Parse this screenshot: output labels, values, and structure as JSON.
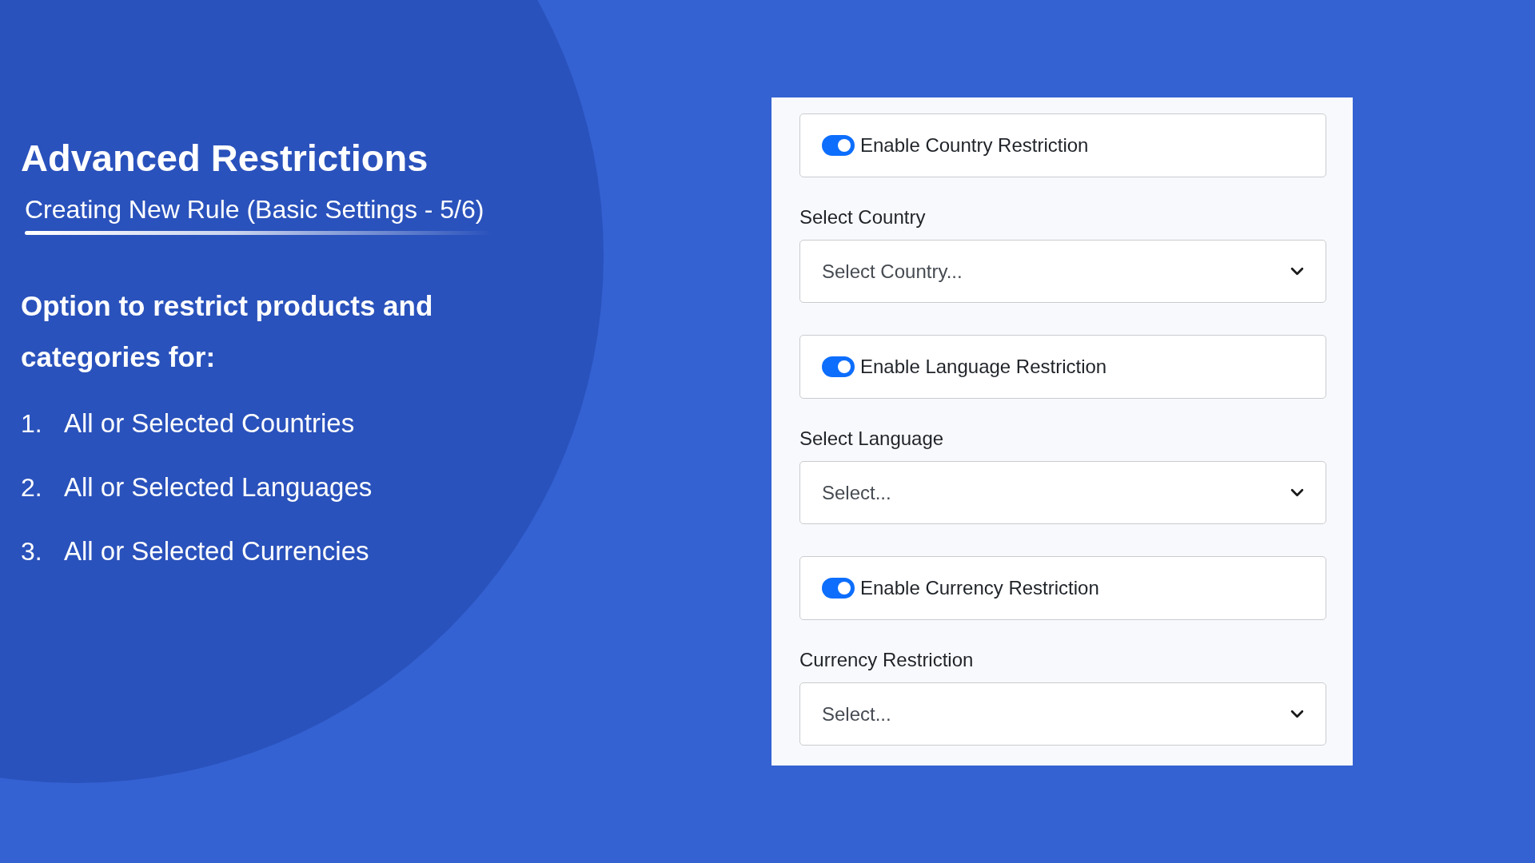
{
  "heading": {
    "title": "Advanced Restrictions",
    "subtitle": "Creating New Rule (Basic Settings - 5/6)"
  },
  "intro": "Option to restrict products and categories for:",
  "list": [
    {
      "number": "1.",
      "text": "All or Selected Countries"
    },
    {
      "number": "2.",
      "text": "All or Selected Languages"
    },
    {
      "number": "3.",
      "text": "All or Selected Currencies"
    }
  ],
  "settings_panel": {
    "sections": [
      {
        "toggle": {
          "label": "Enable Country Restriction",
          "on": true
        },
        "select": {
          "label": "Select Country",
          "placeholder": "Select Country..."
        }
      },
      {
        "toggle": {
          "label": "Enable Language Restriction",
          "on": true
        },
        "select": {
          "label": "Select Language",
          "placeholder": "Select..."
        }
      },
      {
        "toggle": {
          "label": "Enable Currency Restriction",
          "on": true
        },
        "select": {
          "label": "Currency Restriction",
          "placeholder": "Select..."
        }
      }
    ]
  }
}
